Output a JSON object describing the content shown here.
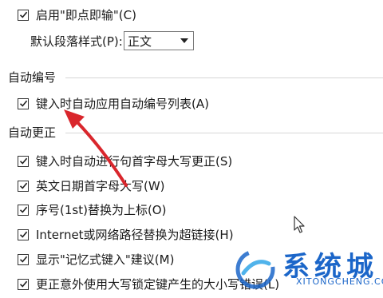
{
  "options_top": {
    "instant_input": {
      "label": "启用\"即点即输\"(C)",
      "checked": true
    },
    "default_paragraph_style": {
      "label": "默认段落样式(P):",
      "value": "正文"
    }
  },
  "groups": [
    {
      "title": "自动编号",
      "items": [
        {
          "label": "键入时自动应用自动编号列表(A)",
          "checked": true
        }
      ]
    },
    {
      "title": "自动更正",
      "items": [
        {
          "label": "键入时自动进行句首字母大写更正(S)",
          "checked": true
        },
        {
          "label": "英文日期首字母大写(W)",
          "checked": true
        },
        {
          "label": "序号(1st)替换为上标(O)",
          "checked": true
        },
        {
          "label": "Internet或网络路径替换为超链接(H)",
          "checked": true
        },
        {
          "label": "显示\"记忆式键入\"建议(M)",
          "checked": true
        },
        {
          "label": "更正意外使用大写锁定键产生的大小写错误(L)",
          "checked": true
        }
      ]
    }
  ],
  "watermark": {
    "text": "系统城",
    "url": "XITONGCHENG.COM"
  },
  "colors": {
    "arrow": "#d9262c",
    "watermark": "#1b66c9"
  }
}
